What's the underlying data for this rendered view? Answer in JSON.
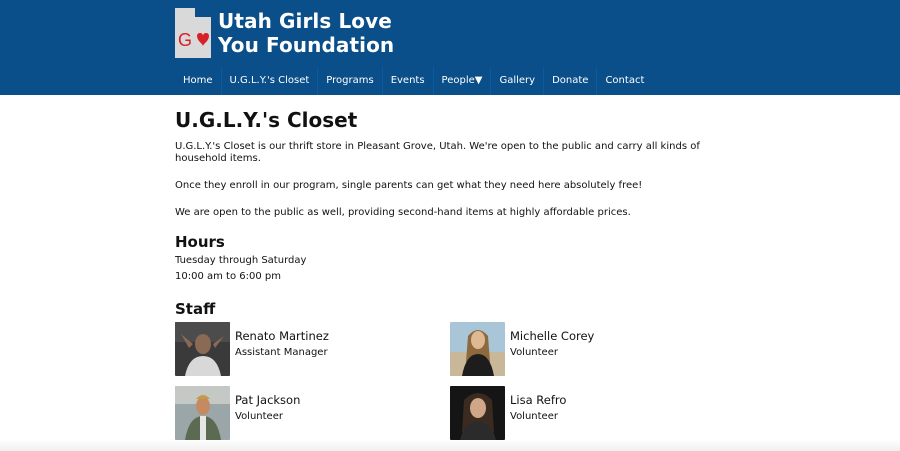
{
  "brand": {
    "title_line1": "Utah Girls Love",
    "title_line2": "You Foundation",
    "logo_letter": "G"
  },
  "nav": [
    {
      "label": "Home"
    },
    {
      "label": "U.G.L.Y.'s Closet"
    },
    {
      "label": "Programs"
    },
    {
      "label": "Events"
    },
    {
      "label": "People▼"
    },
    {
      "label": "Gallery"
    },
    {
      "label": "Donate"
    },
    {
      "label": "Contact"
    }
  ],
  "page": {
    "title": "U.G.L.Y.'s Closet",
    "paragraphs": [
      "U.G.L.Y.'s Closet is our thrift store in Pleasant Grove, Utah. We're open to the public and carry all kinds of household items.",
      "Once they enroll in our program, single parents can get what they need here absolutely free!",
      "We are open to the public as well, providing second-hand items at highly affordable prices."
    ]
  },
  "hours": {
    "heading": "Hours",
    "days": "Tuesday through Saturday",
    "time": "10:00 am to 6:00 pm"
  },
  "staff": {
    "heading": "Staff",
    "members": [
      {
        "name": "Renato Martinez",
        "role": "Assistant Manager"
      },
      {
        "name": "Michelle Corey",
        "role": "Volunteer"
      },
      {
        "name": "Pat Jackson",
        "role": "Volunteer"
      },
      {
        "name": "Lisa Refro",
        "role": "Volunteer"
      }
    ]
  },
  "colors": {
    "header_bg": "#0a4f8a",
    "logo_bg": "#d9d9d9",
    "logo_accent": "#d6202a"
  }
}
